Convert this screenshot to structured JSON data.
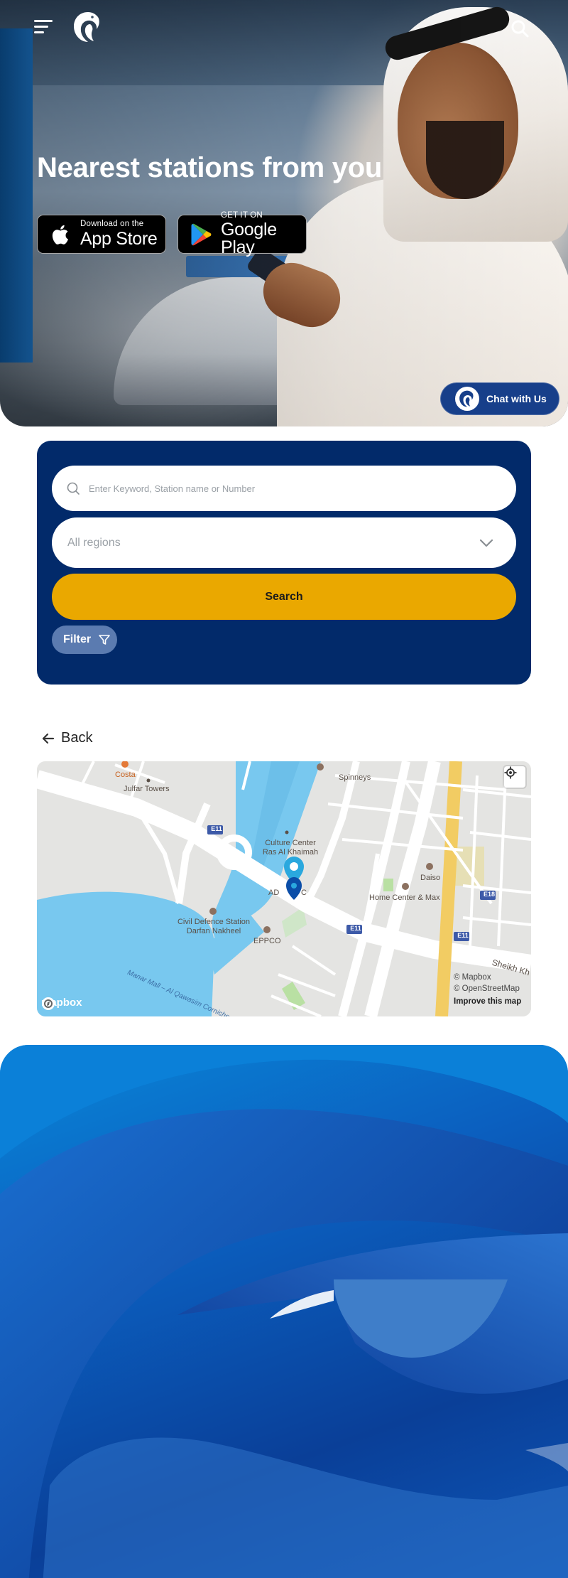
{
  "header": {
    "menu_icon": "hamburger-menu-icon",
    "logo_icon": "falcon-logo-icon",
    "search_icon": "search-icon"
  },
  "hero": {
    "title": "Nearest stations from you",
    "app_store": {
      "small": "Download on the",
      "big": "App Store",
      "icon": "apple-icon"
    },
    "google_play": {
      "small": "GET IT ON",
      "big": "Google Play",
      "icon": "google-play-icon"
    },
    "chat": {
      "label": "Chat with Us",
      "icon": "falcon-avatar-icon"
    }
  },
  "search": {
    "keyword_placeholder": "Enter Keyword, Station name or Number",
    "region_value": "All regions",
    "search_label": "Search",
    "filter_label": "Filter"
  },
  "back": {
    "label": "Back"
  },
  "map": {
    "labels": {
      "costa": "Costa",
      "julfar": "Julfar Towers",
      "spinneys": "Spinneys",
      "culture": "Culture Center Ras Al Khaimah",
      "daiso": "Daiso",
      "home_center": "Home Center & Max",
      "civil_defence": "Civil Defence Station Darfan Nakheel",
      "eppco": "EPPCO",
      "adnoc_partial": "AD",
      "adnoc_partial2": "C",
      "corniche": "Manar Mall – Al Qawasim Corniche",
      "sheikh": "Sheikh Kh",
      "e11": "E11",
      "e18": "E18"
    },
    "mapbox": "mapbox",
    "attribution": [
      "© Mapbox",
      "© OpenStreetMap"
    ],
    "improve": "Improve this map"
  },
  "colors": {
    "panel": "#022a6a",
    "search_button": "#eaa800",
    "filter_button": "#5b7bb0",
    "chat_button": "#173f8a",
    "footer": "#0b5fbf"
  }
}
